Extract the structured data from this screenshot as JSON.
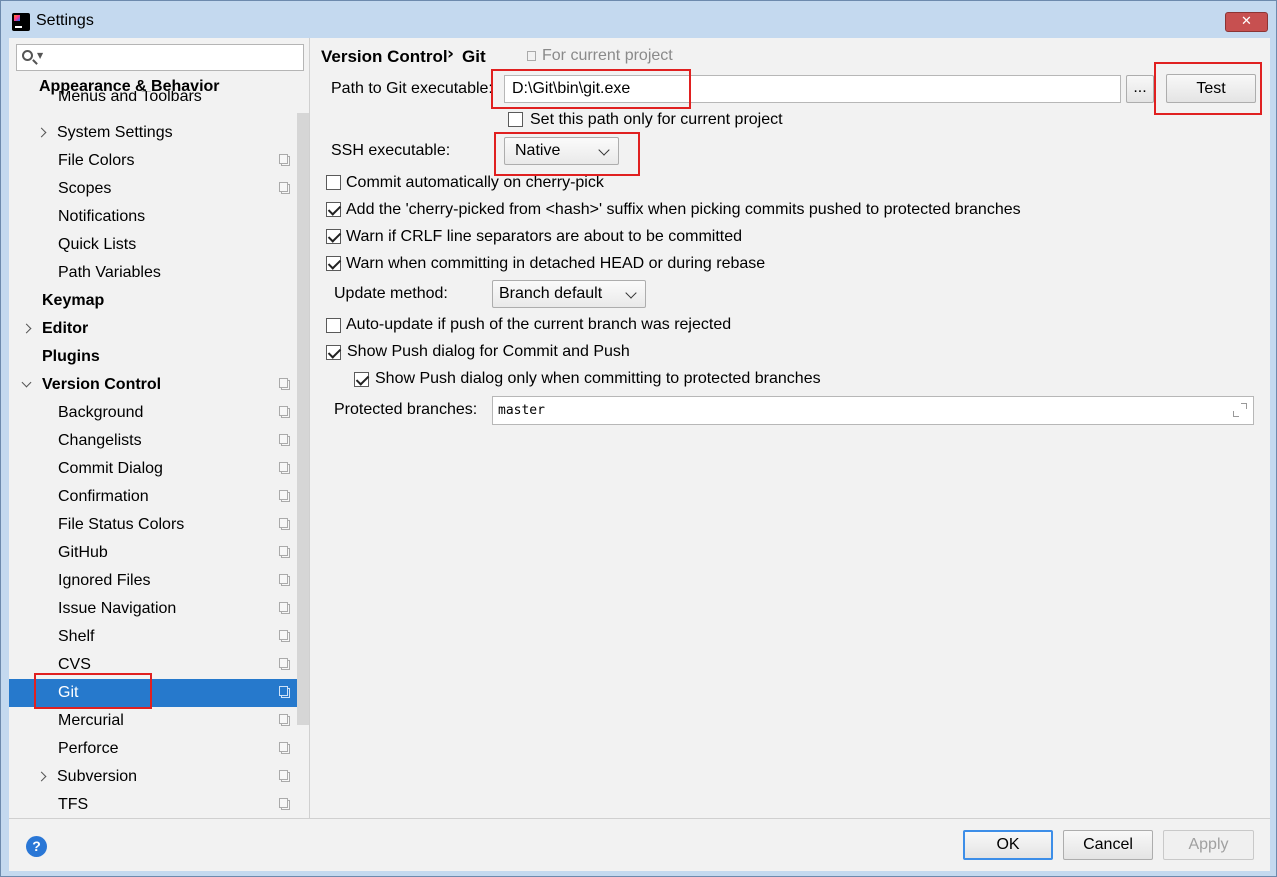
{
  "window": {
    "title": "Settings",
    "close_label": "✕"
  },
  "search": {
    "placeholder": "",
    "value": ""
  },
  "sidebar": {
    "items": [
      {
        "label": "Appearance & Behavior",
        "bold": true
      },
      {
        "label": "Menus and Toolbars"
      },
      {
        "label": "System Settings",
        "expandable": true
      },
      {
        "label": "File Colors",
        "project": true
      },
      {
        "label": "Scopes",
        "project": true
      },
      {
        "label": "Notifications"
      },
      {
        "label": "Quick Lists"
      },
      {
        "label": "Path Variables"
      },
      {
        "label": "Keymap",
        "bold": true
      },
      {
        "label": "Editor",
        "bold": true,
        "expandable": true
      },
      {
        "label": "Plugins",
        "bold": true
      },
      {
        "label": "Version Control",
        "bold": true,
        "expanded": true,
        "project": true
      },
      {
        "label": "Background",
        "project": true
      },
      {
        "label": "Changelists",
        "project": true
      },
      {
        "label": "Commit Dialog",
        "project": true
      },
      {
        "label": "Confirmation",
        "project": true
      },
      {
        "label": "File Status Colors",
        "project": true
      },
      {
        "label": "GitHub",
        "project": true
      },
      {
        "label": "Ignored Files",
        "project": true
      },
      {
        "label": "Issue Navigation",
        "project": true
      },
      {
        "label": "Shelf",
        "project": true
      },
      {
        "label": "CVS",
        "project": true
      },
      {
        "label": "Git",
        "project": true,
        "selected": true
      },
      {
        "label": "Mercurial",
        "project": true
      },
      {
        "label": "Perforce",
        "project": true
      },
      {
        "label": "Subversion",
        "project": true,
        "expandable": true
      },
      {
        "label": "TFS",
        "project": true
      }
    ]
  },
  "header": {
    "crumb_parent": "Version Control",
    "crumb_sep": "›",
    "crumb_current": "Git",
    "scope_note": "For current project"
  },
  "git": {
    "path_label": "Path to Git executable:",
    "path_value": "D:\\Git\\bin\\git.exe",
    "browse_label": "...",
    "test_label": "Test",
    "path_only_project_label": "Set this path only for current project",
    "path_only_project_checked": false,
    "ssh_label": "SSH executable:",
    "ssh_value": "Native",
    "options": [
      {
        "label": "Commit automatically on cherry-pick",
        "checked": false
      },
      {
        "label": "Add the 'cherry-picked from <hash>' suffix when picking commits pushed to protected branches",
        "checked": true
      },
      {
        "label": "Warn if CRLF line separators are about to be committed",
        "checked": true
      },
      {
        "label": "Warn when committing in detached HEAD or during rebase",
        "checked": true
      }
    ],
    "update_method_label": "Update method:",
    "update_method_value": "Branch default",
    "auto_update_label": "Auto-update if push of the current branch was rejected",
    "auto_update_checked": false,
    "show_push_label": "Show Push dialog for Commit and Push",
    "show_push_checked": true,
    "show_push_protected_label": "Show Push dialog only when committing to protected branches",
    "show_push_protected_checked": true,
    "protected_branches_label": "Protected branches:",
    "protected_branches_value": "master"
  },
  "footer": {
    "help_label": "?",
    "ok_label": "OK",
    "cancel_label": "Cancel",
    "apply_label": "Apply"
  },
  "colors": {
    "selection": "#2679cc",
    "highlight_box": "#e02020",
    "title_bar": "#c4d9ef"
  }
}
